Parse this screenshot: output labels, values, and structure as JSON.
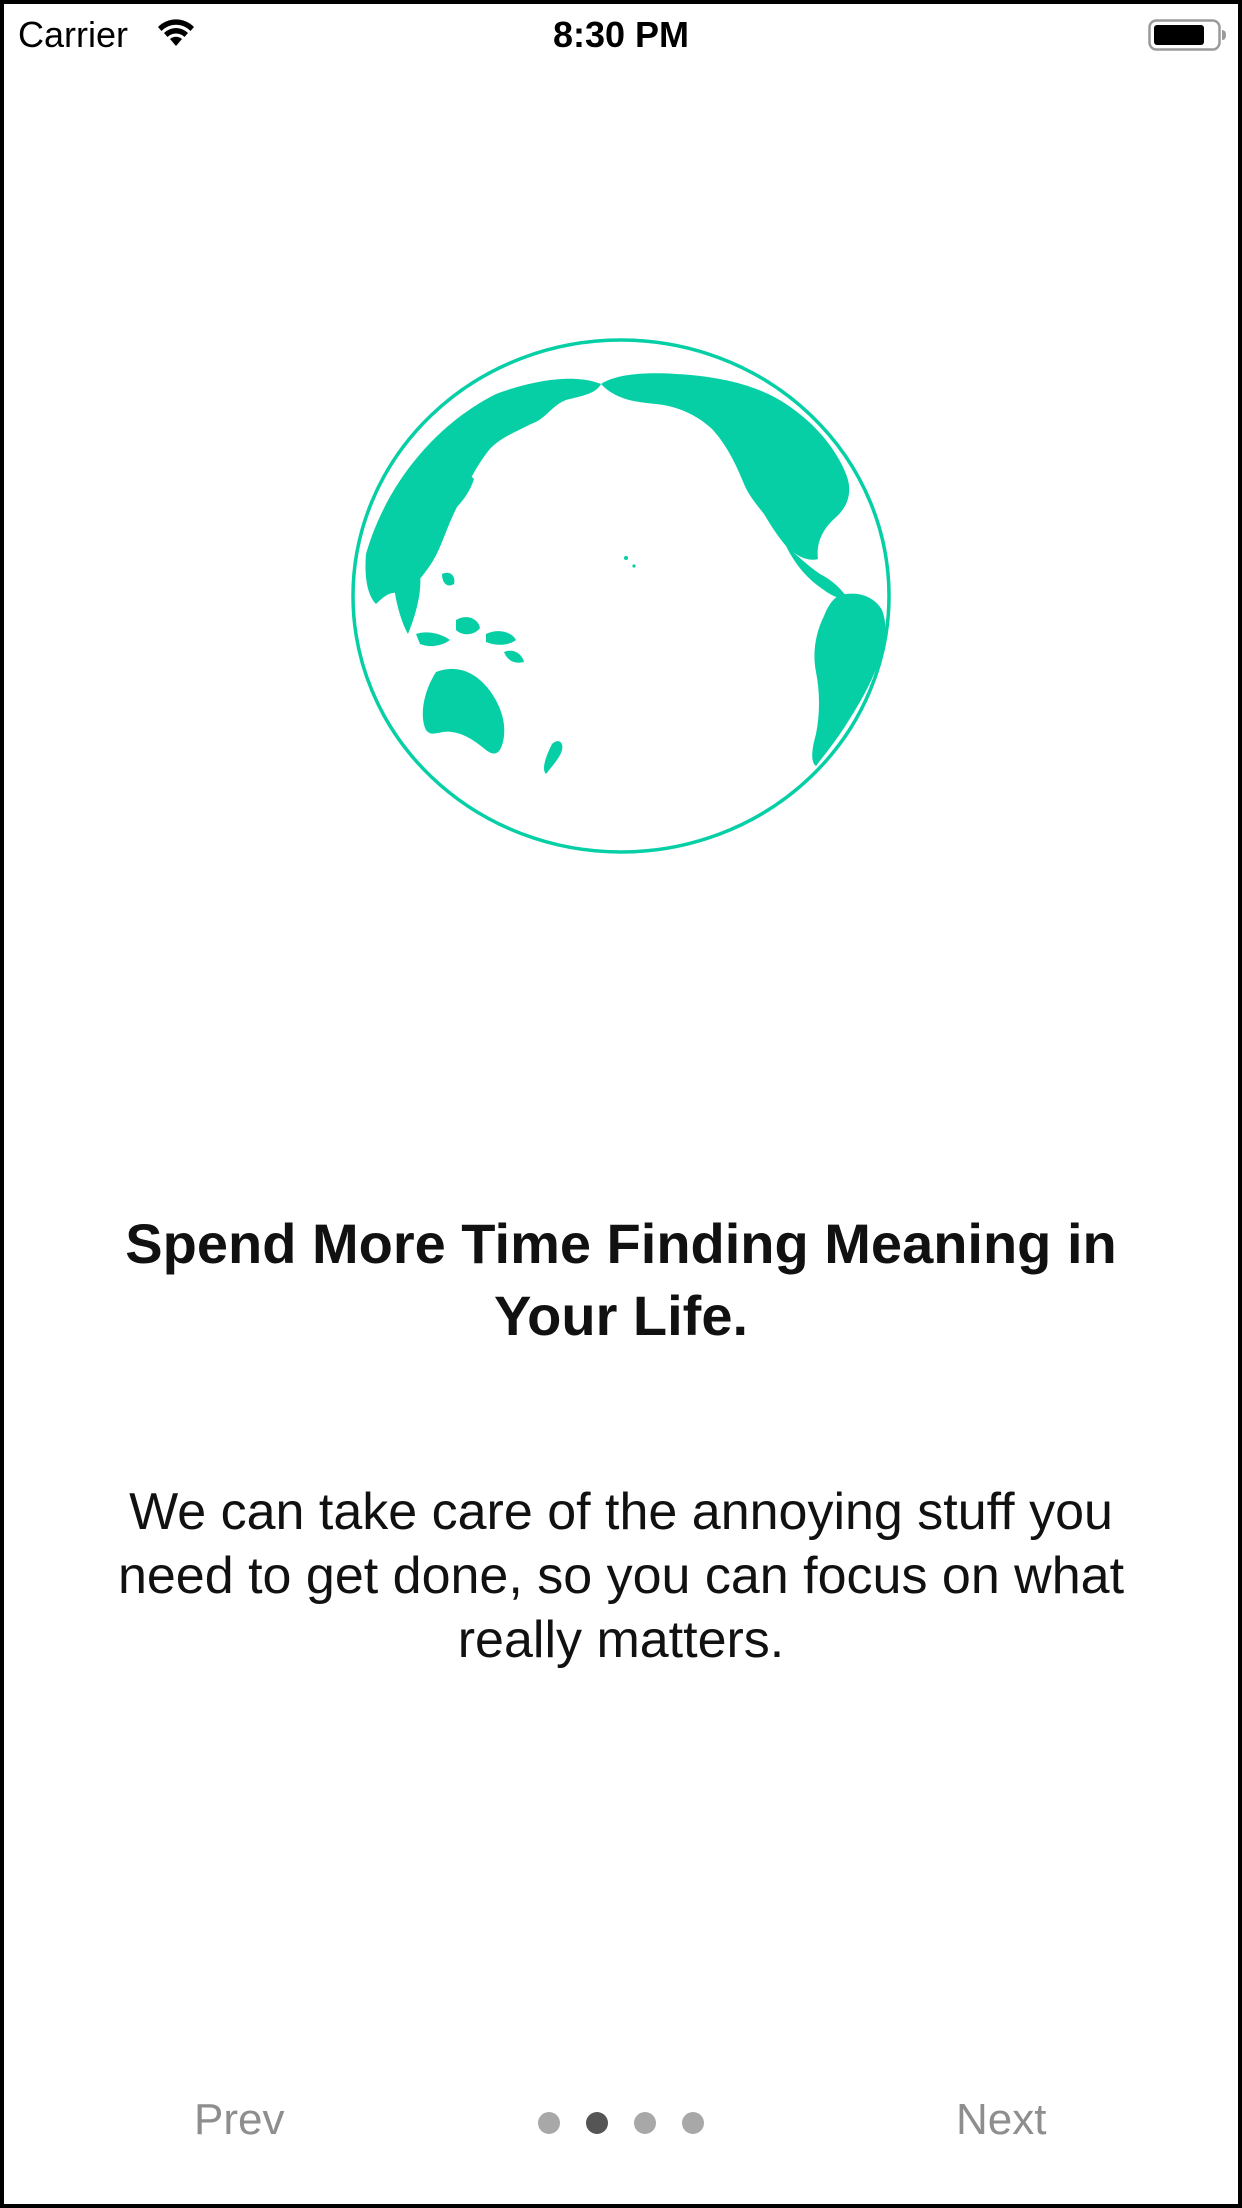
{
  "status_bar": {
    "carrier": "Carrier",
    "time": "8:30 PM"
  },
  "slide": {
    "illustration": "globe-icon",
    "title": "Spend More Time Finding Meaning in Your Life.",
    "description": "We can take care of the annoying stuff you need to get done, so you can focus on what really matters."
  },
  "navigation": {
    "prev_label": "Prev",
    "next_label": "Next",
    "page_count": 4,
    "current_page": 2
  },
  "colors": {
    "accent": "#06CFA5",
    "nav_text": "#8E8E8E",
    "dot_inactive": "#A8A8A8",
    "dot_active": "#555555"
  }
}
